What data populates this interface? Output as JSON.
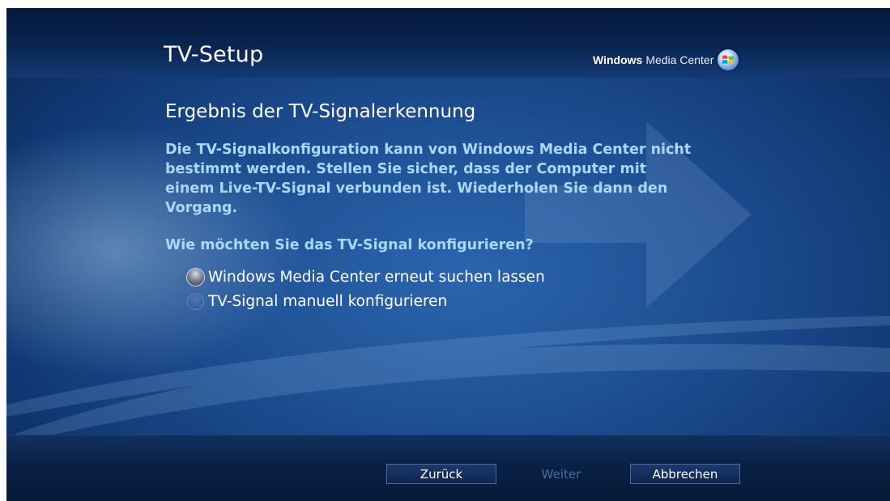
{
  "window": {
    "title": "TV-Setup"
  },
  "brand": {
    "bold": "Windows",
    "rest": "Media Center",
    "icon": "windows-flag-icon"
  },
  "main": {
    "heading": "Ergebnis der TV-Signalerkennung",
    "message": "Die TV-Signalkonfiguration kann von Windows Media Center nicht bestimmt werden. Stellen Sie sicher, dass der Computer mit einem Live-TV-Signal verbunden ist. Wiederholen Sie dann den Vorgang.",
    "question": "Wie möchten Sie das TV-Signal konfigurieren?",
    "options": [
      {
        "label": "Windows Media Center erneut suchen lassen",
        "selected": true
      },
      {
        "label": "TV-Signal manuell konfigurieren",
        "selected": false
      }
    ]
  },
  "footer": {
    "back_label": "Zurück",
    "next_label": "Weiter",
    "next_enabled": false,
    "cancel_label": "Abbrechen"
  },
  "colors": {
    "background": "#1e4f93",
    "accent_text": "#a9d8ff",
    "disabled_text": "#4e6c96"
  }
}
